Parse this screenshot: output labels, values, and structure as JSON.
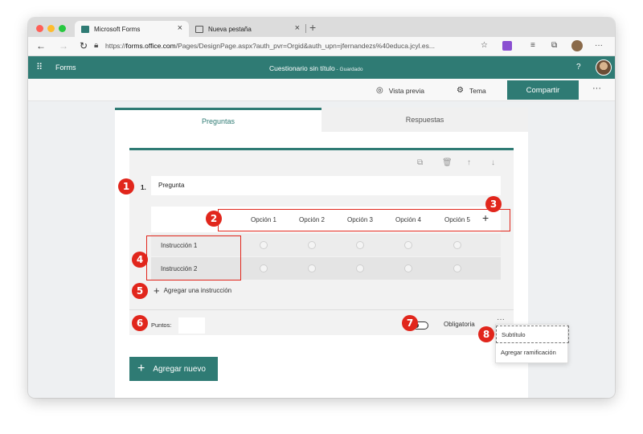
{
  "browser": {
    "tabs": [
      {
        "label": "Microsoft Forms",
        "close": "×"
      },
      {
        "label": "Nueva pestaña",
        "close": "×"
      }
    ],
    "new_tab": "+",
    "url_prefix": "https://",
    "url_host": "forms.office.com",
    "url_path": "/Pages/DesignPage.aspx?auth_pvr=Orgid&auth_upn=jfernandezs%40educa.jcyl.es...",
    "more": "···"
  },
  "forms_header": {
    "app_name": "Forms",
    "doc_title": "Cuestionario sin título",
    "saved_status": " - Guardado",
    "help": "?"
  },
  "command_bar": {
    "preview_label": "Vista previa",
    "theme_label": "Tema",
    "share_label": "Compartir",
    "more": "···"
  },
  "form_tabs": {
    "questions": "Preguntas",
    "responses": "Respuestas"
  },
  "question": {
    "number": "1.",
    "title": "Pregunta",
    "options": [
      "Opción 1",
      "Opción 2",
      "Opción 3",
      "Opción 4",
      "Opción 5"
    ],
    "add_option": "+",
    "statements": [
      "Instrucción 1",
      "Instrucción 2"
    ],
    "add_statement": "Agregar una instrucción",
    "points_label": "Puntos:",
    "required_label": "Obligatoria",
    "more": "···",
    "required_on": false
  },
  "add_new": "Agregar nuevo",
  "menu": {
    "items": [
      "Subtítulo",
      "Agregar ramificación"
    ]
  },
  "annotations": [
    "1",
    "2",
    "3",
    "4",
    "5",
    "6",
    "7",
    "8"
  ],
  "colors": {
    "brand": "#2f7b74",
    "annotation": "#e1261c"
  }
}
